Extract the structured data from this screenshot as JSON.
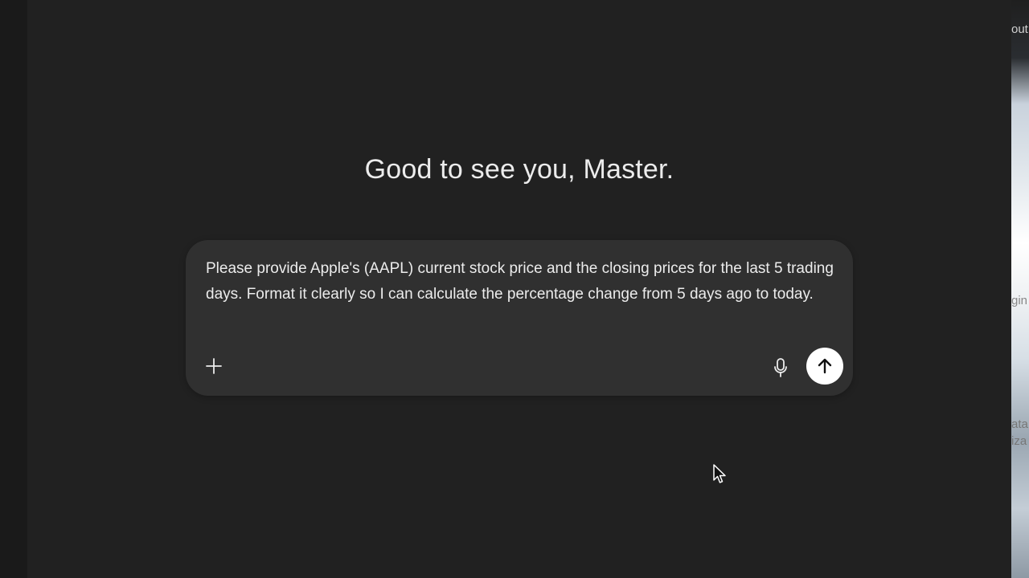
{
  "greeting": "Good to see you, Master.",
  "composer": {
    "prompt": "Please provide Apple's (AAPL) current stock price and the closing prices for the last 5 trading days. Format it clearly so I can calculate the percentage change from 5 days ago to today.",
    "add_icon": "plus-icon",
    "mic_icon": "microphone-icon",
    "send_icon": "arrow-up-icon"
  },
  "background_window": {
    "frag_top": "out",
    "frag_mid": "gin",
    "frag_low1": "ata",
    "frag_low2": "iza"
  },
  "colors": {
    "page_bg": "#212121",
    "composer_bg": "#303030",
    "text": "#ececec",
    "send_button_bg": "#ffffff"
  }
}
